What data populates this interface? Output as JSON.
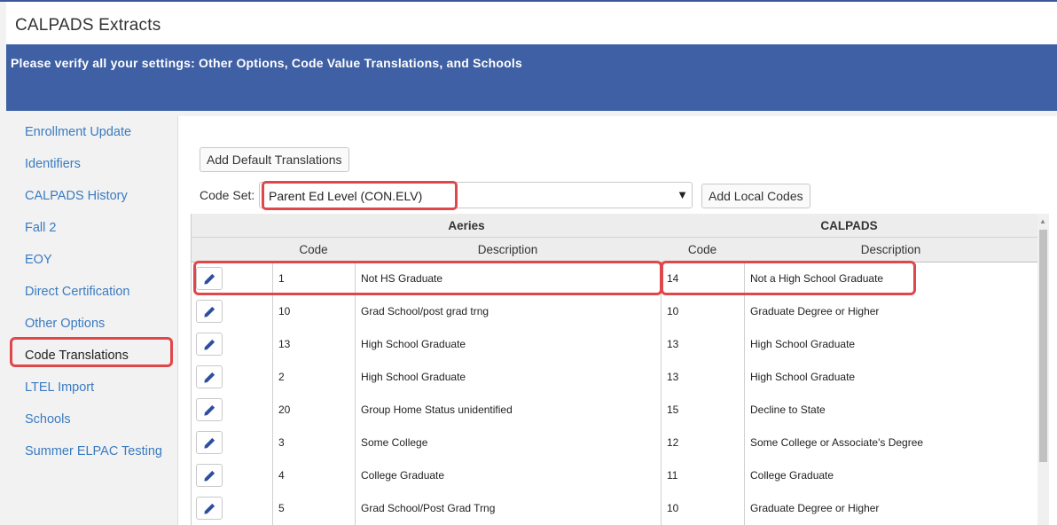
{
  "app": {
    "title": "CALPADS Extracts",
    "banner_message": "Please verify all your settings: Other Options, Code Value Translations, and Schools"
  },
  "sidebar": {
    "items": [
      {
        "label": "Enrollment Update"
      },
      {
        "label": "Identifiers"
      },
      {
        "label": "CALPADS History"
      },
      {
        "label": "Fall 2"
      },
      {
        "label": "EOY"
      },
      {
        "label": "Direct Certification"
      },
      {
        "label": "Other Options"
      },
      {
        "label": "Code Translations"
      },
      {
        "label": "LTEL Import"
      },
      {
        "label": "Schools"
      },
      {
        "label": "Summer ELPAC Testing"
      }
    ],
    "active": "Code Translations"
  },
  "toolbar": {
    "add_default_label": "Add Default Translations",
    "code_set_label": "Code Set:",
    "code_set_value": "Parent Ed Level (CON.ELV)",
    "add_local_label": "Add Local Codes"
  },
  "table": {
    "group_headers": {
      "aeries": "Aeries",
      "calpads": "CALPADS"
    },
    "columns": {
      "aeries_code": "Code",
      "aeries_desc": "Description",
      "calpads_code": "Code",
      "calpads_desc": "Description"
    },
    "rows": [
      {
        "aeries_code": "1",
        "aeries_desc": "Not HS Graduate",
        "calpads_code": "14",
        "calpads_desc": "Not a High School Graduate"
      },
      {
        "aeries_code": "10",
        "aeries_desc": "Grad School/post grad trng",
        "calpads_code": "10",
        "calpads_desc": "Graduate Degree or Higher"
      },
      {
        "aeries_code": "13",
        "aeries_desc": "High School Graduate",
        "calpads_code": "13",
        "calpads_desc": "High School Graduate"
      },
      {
        "aeries_code": "2",
        "aeries_desc": "High School Graduate",
        "calpads_code": "13",
        "calpads_desc": "High School Graduate"
      },
      {
        "aeries_code": "20",
        "aeries_desc": "Group Home Status unidentified",
        "calpads_code": "15",
        "calpads_desc": "Decline to State"
      },
      {
        "aeries_code": "3",
        "aeries_desc": "Some College",
        "calpads_code": "12",
        "calpads_desc": "Some College or Associate's Degree"
      },
      {
        "aeries_code": "4",
        "aeries_desc": "College Graduate",
        "calpads_code": "11",
        "calpads_desc": "College Graduate"
      },
      {
        "aeries_code": "5",
        "aeries_desc": "Grad School/Post Grad Trng",
        "calpads_code": "10",
        "calpads_desc": "Graduate Degree or Higher"
      }
    ]
  },
  "colors": {
    "banner": "#3f60a4",
    "link": "#3a7bc0",
    "highlight": "#e0474a",
    "edit_icon": "#2d4f9e"
  },
  "icons": {
    "edit": "pencil-icon",
    "dropdown": "triangle-down-icon",
    "scroll_up": "triangle-up-icon"
  }
}
